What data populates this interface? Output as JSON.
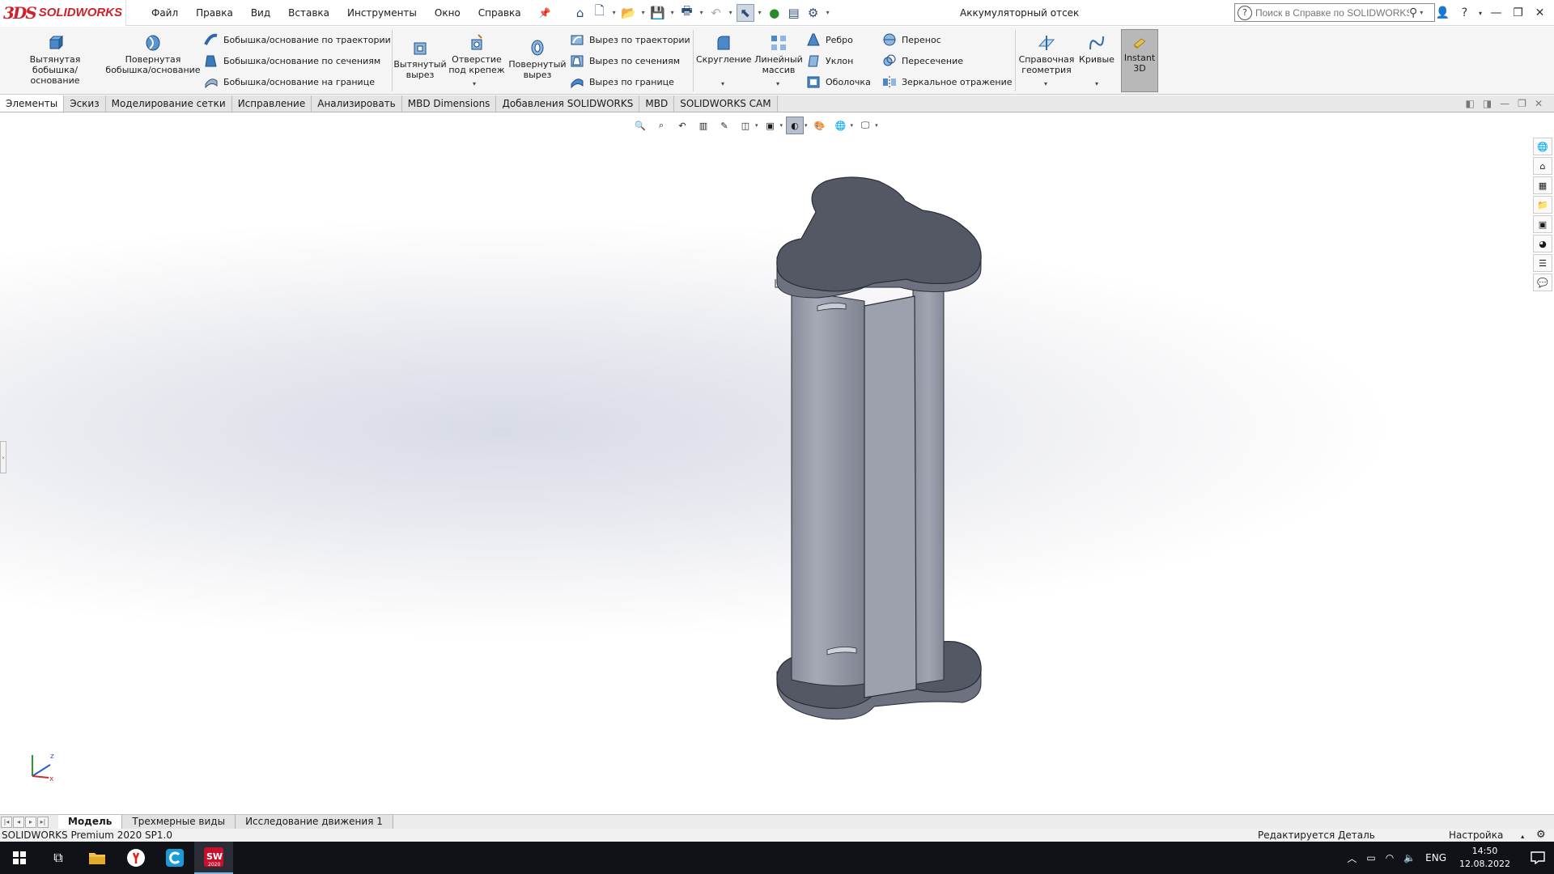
{
  "app": {
    "logo_ds": "3DS",
    "logo_name": "SOLIDWORKS",
    "document_title": "Аккумуляторный отсек",
    "help_search_placeholder": "Поиск в Справке по SOLIDWORKS"
  },
  "menu": [
    "Файл",
    "Правка",
    "Вид",
    "Вставка",
    "Инструменты",
    "Окно",
    "Справка"
  ],
  "ribbon": {
    "extruded_boss": "Вытянутая\nбобышка/основание",
    "revolved_boss": "Повернутая\nбобышка/основание",
    "swept_boss": "Бобышка/основание по траектории",
    "lofted_boss": "Бобышка/основание по сечениям",
    "boundary_boss": "Бобышка/основание на границе",
    "extruded_cut": "Вытянутый\nвырез",
    "hole_wizard": "Отверстие\nпод крепеж",
    "revolved_cut": "Повернутый\nвырез",
    "swept_cut": "Вырез по траектории",
    "lofted_cut": "Вырез по сечениям",
    "boundary_cut": "Вырез по границе",
    "fillet": "Скругление",
    "linear_pattern": "Линейный\nмассив",
    "rib": "Ребро",
    "draft": "Уклон",
    "shell": "Оболочка",
    "wrap": "Перенос",
    "intersect": "Пересечение",
    "mirror": "Зеркальное отражение",
    "ref_geometry": "Справочная\nгеометрия",
    "curves": "Кривые",
    "instant3d": "Instant\n3D"
  },
  "tabs": [
    "Элементы",
    "Эскиз",
    "Моделирование сетки",
    "Исправление",
    "Анализировать",
    "MBD Dimensions",
    "Добавления SOLIDWORKS",
    "MBD",
    "SOLIDWORKS CAM"
  ],
  "active_tab": "Элементы",
  "bottom_tabs": [
    "Модель",
    "Трехмерные виды",
    "Исследование движения 1"
  ],
  "status": {
    "product": "SOLIDWORKS Premium 2020 SP1.0",
    "mode": "Редактируется Деталь",
    "customize": "Настройка"
  },
  "taskbar": {
    "solidworks_badge": "2020",
    "language": "ENG",
    "time": "14:50",
    "date": "12.08.2022"
  },
  "triad": {
    "z": "z",
    "x": "x"
  },
  "colors": {
    "brand_red": "#d0202a",
    "model_dark": "#545764",
    "model_light": "#9599a6",
    "model_mid": "#7f8391"
  }
}
